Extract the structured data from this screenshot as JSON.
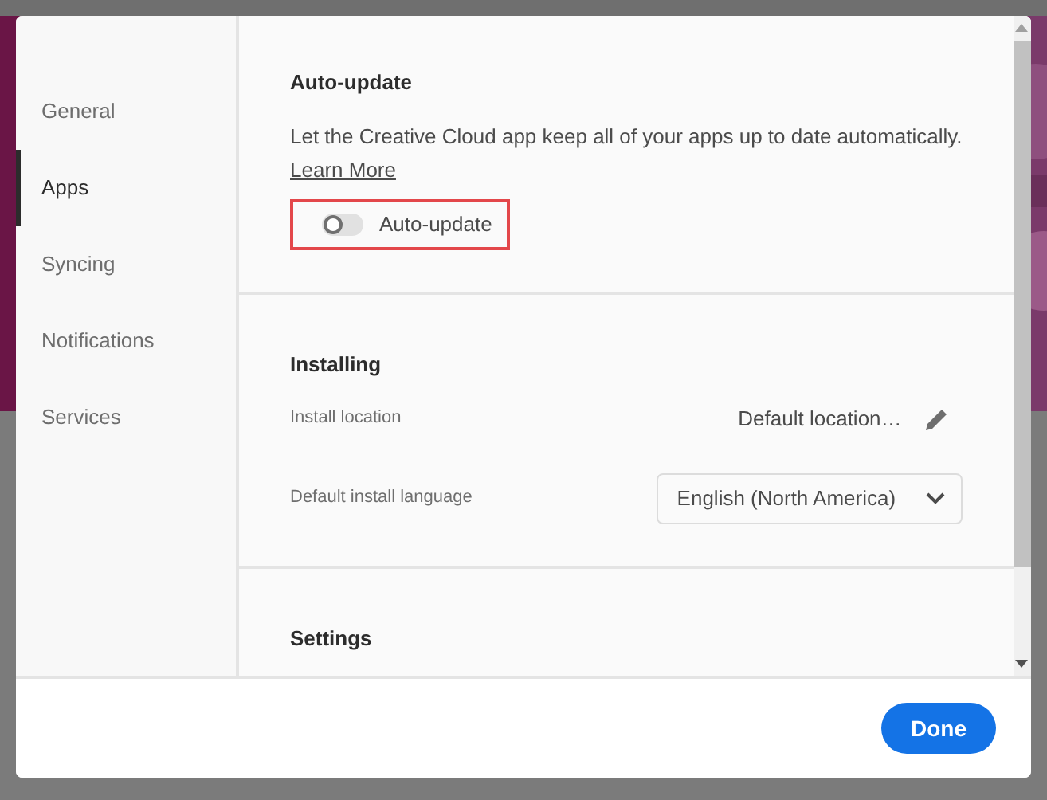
{
  "sidebar": {
    "items": [
      {
        "label": "General",
        "selected": false
      },
      {
        "label": "Apps",
        "selected": true
      },
      {
        "label": "Syncing",
        "selected": false
      },
      {
        "label": "Notifications",
        "selected": false
      },
      {
        "label": "Services",
        "selected": false
      }
    ]
  },
  "auto_update": {
    "title": "Auto-update",
    "description": "Let the Creative Cloud app keep all of your apps up to date automatically.",
    "link": "Learn More",
    "toggle": {
      "label": "Auto-update",
      "on": false,
      "highlighted": true
    }
  },
  "installing": {
    "title": "Installing",
    "location": {
      "label": "Install location",
      "value": "Default location…"
    },
    "language": {
      "label": "Default install language",
      "value": "English (North America)"
    }
  },
  "settings": {
    "title": "Settings"
  },
  "footer": {
    "button": "Done"
  }
}
